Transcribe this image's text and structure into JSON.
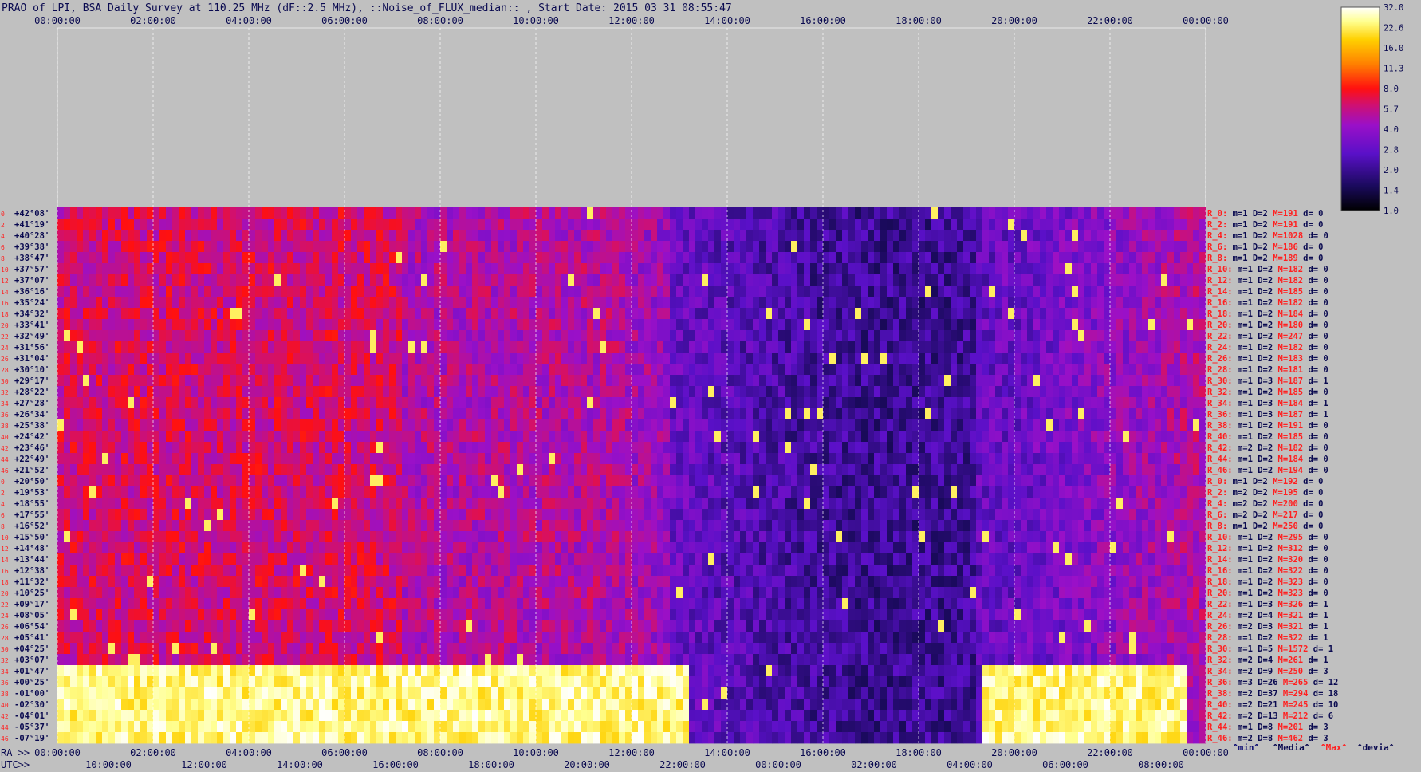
{
  "chart_data": {
    "type": "heatmap",
    "title": "PRAO of LPI, BSA Daily Survey at 110.25 MHz (dF::2.5 MHz), ::Noise_of_FLUX_median:: , Start Date: 2015 03 31 08:55:47",
    "top_time_ticks": [
      "00:00:00",
      "02:00:00",
      "04:00:00",
      "06:00:00",
      "08:00:00",
      "10:00:00",
      "12:00:00",
      "14:00:00",
      "16:00:00",
      "18:00:00",
      "20:00:00",
      "22:00:00",
      "00:00:00"
    ],
    "ra_label": "RA >>",
    "ra_ticks": [
      "00:00:00",
      "02:00:00",
      "04:00:00",
      "06:00:00",
      "08:00:00",
      "10:00:00",
      "12:00:00",
      "14:00:00",
      "16:00:00",
      "18:00:00",
      "20:00:00",
      "22:00:00",
      "00:00:00"
    ],
    "utc_label": "UTC>>",
    "utc_ticks": [
      "10:00:00",
      "12:00:00",
      "14:00:00",
      "16:00:00",
      "18:00:00",
      "20:00:00",
      "22:00:00",
      "00:00:00",
      "02:00:00",
      "04:00:00",
      "06:00:00",
      "08:00:00"
    ],
    "colorbar": {
      "ticks": [
        "32.0",
        "22.6",
        "16.0",
        "11.3",
        "8.0",
        "5.7",
        "4.0",
        "2.8",
        "2.0",
        "1.4",
        "1.0"
      ]
    },
    "rows": [
      {
        "idx": "0",
        "dec": "+42°08'",
        "R": "R_0:",
        "m": "m=1",
        "D": "D=2",
        "M": "M=191",
        "d": "d= 0"
      },
      {
        "idx": "2",
        "dec": "+41°19'",
        "R": "R_2:",
        "m": "m=1",
        "D": "D=2",
        "M": "M=191",
        "d": "d= 0"
      },
      {
        "idx": "4",
        "dec": "+40°28'",
        "R": "R_4:",
        "m": "m=1",
        "D": "D=2",
        "M": "M=1028",
        "d": "d= 0"
      },
      {
        "idx": "6",
        "dec": "+39°38'",
        "R": "R_6:",
        "m": "m=1",
        "D": "D=2",
        "M": "M=186",
        "d": "d= 0"
      },
      {
        "idx": "8",
        "dec": "+38°47'",
        "R": "R_8:",
        "m": "m=1",
        "D": "D=2",
        "M": "M=189",
        "d": "d= 0"
      },
      {
        "idx": "10",
        "dec": "+37°57'",
        "R": "R_10:",
        "m": "m=1",
        "D": "D=2",
        "M": "M=182",
        "d": "d= 0"
      },
      {
        "idx": "12",
        "dec": "+37°07'",
        "R": "R_12:",
        "m": "m=1",
        "D": "D=2",
        "M": "M=182",
        "d": "d= 0"
      },
      {
        "idx": "14",
        "dec": "+36°16'",
        "R": "R_14:",
        "m": "m=1",
        "D": "D=2",
        "M": "M=185",
        "d": "d= 0"
      },
      {
        "idx": "16",
        "dec": "+35°24'",
        "R": "R_16:",
        "m": "m=1",
        "D": "D=2",
        "M": "M=182",
        "d": "d= 0"
      },
      {
        "idx": "18",
        "dec": "+34°32'",
        "R": "R_18:",
        "m": "m=1",
        "D": "D=2",
        "M": "M=184",
        "d": "d= 0"
      },
      {
        "idx": "20",
        "dec": "+33°41'",
        "R": "R_20:",
        "m": "m=1",
        "D": "D=2",
        "M": "M=180",
        "d": "d= 0"
      },
      {
        "idx": "22",
        "dec": "+32°49'",
        "R": "R_22:",
        "m": "m=1",
        "D": "D=2",
        "M": "M=247",
        "d": "d= 0"
      },
      {
        "idx": "24",
        "dec": "+31°56'",
        "R": "R_24:",
        "m": "m=1",
        "D": "D=2",
        "M": "M=182",
        "d": "d= 0"
      },
      {
        "idx": "26",
        "dec": "+31°04'",
        "R": "R_26:",
        "m": "m=1",
        "D": "D=2",
        "M": "M=183",
        "d": "d= 0"
      },
      {
        "idx": "28",
        "dec": "+30°10'",
        "R": "R_28:",
        "m": "m=1",
        "D": "D=2",
        "M": "M=181",
        "d": "d= 0"
      },
      {
        "idx": "30",
        "dec": "+29°17'",
        "R": "R_30:",
        "m": "m=1",
        "D": "D=3",
        "M": "M=187",
        "d": "d= 1"
      },
      {
        "idx": "32",
        "dec": "+28°22'",
        "R": "R_32:",
        "m": "m=1",
        "D": "D=2",
        "M": "M=185",
        "d": "d= 0"
      },
      {
        "idx": "34",
        "dec": "+27°28'",
        "R": "R_34:",
        "m": "m=1",
        "D": "D=3",
        "M": "M=184",
        "d": "d= 1"
      },
      {
        "idx": "36",
        "dec": "+26°34'",
        "R": "R_36:",
        "m": "m=1",
        "D": "D=3",
        "M": "M=187",
        "d": "d= 1"
      },
      {
        "idx": "38",
        "dec": "+25°38'",
        "R": "R_38:",
        "m": "m=1",
        "D": "D=2",
        "M": "M=191",
        "d": "d= 0"
      },
      {
        "idx": "40",
        "dec": "+24°42'",
        "R": "R_40:",
        "m": "m=1",
        "D": "D=2",
        "M": "M=185",
        "d": "d= 0"
      },
      {
        "idx": "42",
        "dec": "+23°46'",
        "R": "R_42:",
        "m": "m=2",
        "D": "D=2",
        "M": "M=182",
        "d": "d= 0"
      },
      {
        "idx": "44",
        "dec": "+22°49'",
        "R": "R_44:",
        "m": "m=1",
        "D": "D=2",
        "M": "M=184",
        "d": "d= 0"
      },
      {
        "idx": "46",
        "dec": "+21°52'",
        "R": "R_46:",
        "m": "m=1",
        "D": "D=2",
        "M": "M=194",
        "d": "d= 0"
      },
      {
        "idx": "0",
        "dec": "+20°50'",
        "R": "R_0:",
        "m": "m=1",
        "D": "D=2",
        "M": "M=192",
        "d": "d= 0"
      },
      {
        "idx": "2",
        "dec": "+19°53'",
        "R": "R_2:",
        "m": "m=2",
        "D": "D=2",
        "M": "M=195",
        "d": "d= 0"
      },
      {
        "idx": "4",
        "dec": "+18°55'",
        "R": "R_4:",
        "m": "m=2",
        "D": "D=2",
        "M": "M=200",
        "d": "d= 0"
      },
      {
        "idx": "6",
        "dec": "+17°55'",
        "R": "R_6:",
        "m": "m=2",
        "D": "D=2",
        "M": "M=217",
        "d": "d= 0"
      },
      {
        "idx": "8",
        "dec": "+16°52'",
        "R": "R_8:",
        "m": "m=1",
        "D": "D=2",
        "M": "M=250",
        "d": "d= 0"
      },
      {
        "idx": "10",
        "dec": "+15°50'",
        "R": "R_10:",
        "m": "m=1",
        "D": "D=2",
        "M": "M=295",
        "d": "d= 0"
      },
      {
        "idx": "12",
        "dec": "+14°48'",
        "R": "R_12:",
        "m": "m=1",
        "D": "D=2",
        "M": "M=312",
        "d": "d= 0"
      },
      {
        "idx": "14",
        "dec": "+13°44'",
        "R": "R_14:",
        "m": "m=1",
        "D": "D=2",
        "M": "M=320",
        "d": "d= 0"
      },
      {
        "idx": "16",
        "dec": "+12°38'",
        "R": "R_16:",
        "m": "m=1",
        "D": "D=2",
        "M": "M=322",
        "d": "d= 0"
      },
      {
        "idx": "18",
        "dec": "+11°32'",
        "R": "R_18:",
        "m": "m=1",
        "D": "D=2",
        "M": "M=323",
        "d": "d= 0"
      },
      {
        "idx": "20",
        "dec": "+10°25'",
        "R": "R_20:",
        "m": "m=1",
        "D": "D=2",
        "M": "M=323",
        "d": "d= 0"
      },
      {
        "idx": "22",
        "dec": "+09°17'",
        "R": "R_22:",
        "m": "m=1",
        "D": "D=3",
        "M": "M=326",
        "d": "d= 1"
      },
      {
        "idx": "24",
        "dec": "+08°05'",
        "R": "R_24:",
        "m": "m=2",
        "D": "D=4",
        "M": "M=321",
        "d": "d= 1"
      },
      {
        "idx": "26",
        "dec": "+06°54'",
        "R": "R_26:",
        "m": "m=2",
        "D": "D=3",
        "M": "M=321",
        "d": "d= 1"
      },
      {
        "idx": "28",
        "dec": "+05°41'",
        "R": "R_28:",
        "m": "m=1",
        "D": "D=2",
        "M": "M=322",
        "d": "d= 1"
      },
      {
        "idx": "30",
        "dec": "+04°25'",
        "R": "R_30:",
        "m": "m=1",
        "D": "D=5",
        "M": "M=1572",
        "d": "d= 1"
      },
      {
        "idx": "32",
        "dec": "+03°07'",
        "R": "R_32:",
        "m": "m=2",
        "D": "D=4",
        "M": "M=261",
        "d": "d= 1"
      },
      {
        "idx": "34",
        "dec": "+01°47'",
        "R": "R_34:",
        "m": "m=2",
        "D": "D=9",
        "M": "M=250",
        "d": "d= 3"
      },
      {
        "idx": "36",
        "dec": "+00°25'",
        "R": "R_36:",
        "m": "m=3",
        "D": "D=26",
        "M": "M=265",
        "d": "d= 12"
      },
      {
        "idx": "38",
        "dec": "-01°00'",
        "R": "R_38:",
        "m": "m=2",
        "D": "D=37",
        "M": "M=294",
        "d": "d= 18"
      },
      {
        "idx": "40",
        "dec": "-02°30'",
        "R": "R_40:",
        "m": "m=2",
        "D": "D=21",
        "M": "M=245",
        "d": "d= 10"
      },
      {
        "idx": "42",
        "dec": "-04°01'",
        "R": "R_42:",
        "m": "m=2",
        "D": "D=13",
        "M": "M=212",
        "d": "d= 6"
      },
      {
        "idx": "44",
        "dec": "-05°37'",
        "R": "R_44:",
        "m": "m=1",
        "D": "D=8",
        "M": "M=201",
        "d": "d= 3"
      },
      {
        "idx": "46",
        "dec": "-07°19'",
        "R": "R_46:",
        "m": "m=2",
        "D": "D=8",
        "M": "M=462",
        "d": "d= 3"
      }
    ],
    "legend": [
      "^min^",
      "^Media^",
      "^Max^",
      "^devia^"
    ],
    "colors": {
      "background": "#c0c0c0",
      "text_dark": "#0a0a50",
      "stat_red": "#ff2020",
      "legend_min": "#0a0a70",
      "legend_max": "#ff2020",
      "grid": "#ffffff"
    }
  }
}
